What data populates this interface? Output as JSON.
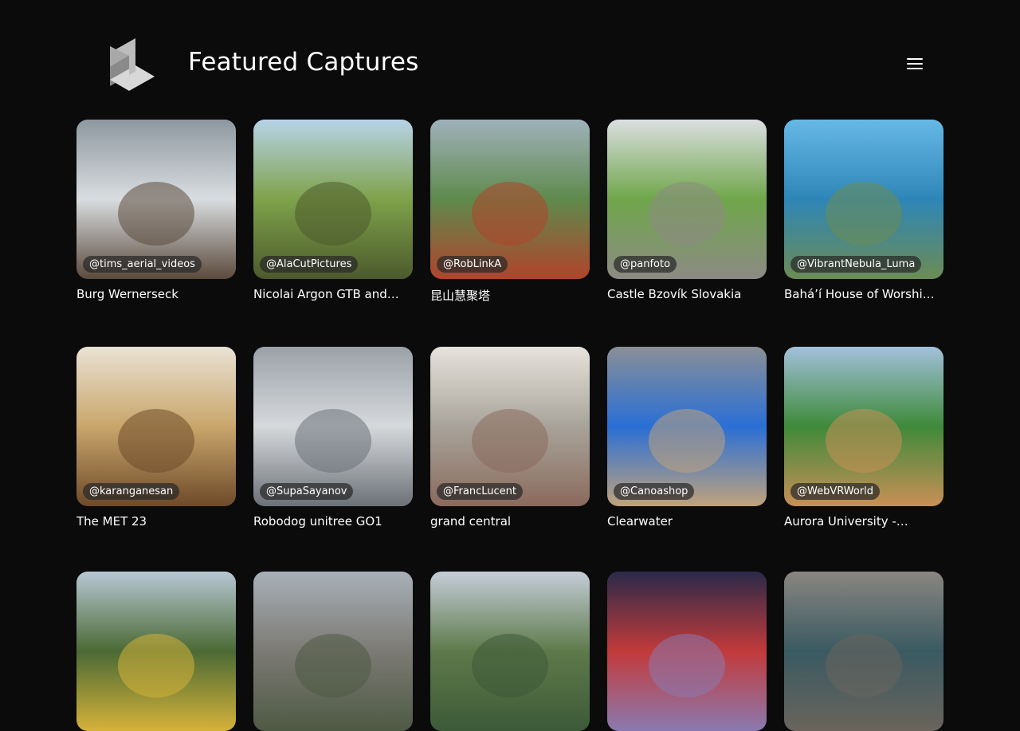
{
  "header": {
    "title": "Featured Captures",
    "logo_icon": "cube-logo-icon",
    "menu_icon": "hamburger-menu-icon"
  },
  "captures": [
    {
      "handle": "@tims_aerial_videos",
      "title": "Burg Wernerseck",
      "colors": [
        "#8e98a0",
        "#d9dde0",
        "#5b4a3c"
      ]
    },
    {
      "handle": "@AlaCutPictures",
      "title": "Nicolai Argon GTB and…",
      "colors": [
        "#b7d3e8",
        "#7ea24a",
        "#4c5a2c"
      ]
    },
    {
      "handle": "@RobLinkA",
      "title": "昆山慧聚塔",
      "colors": [
        "#9fb1bb",
        "#5f8a4c",
        "#b0442c"
      ]
    },
    {
      "handle": "@panfoto",
      "title": "Castle Bzovík Slovakia",
      "colors": [
        "#dcdfe2",
        "#6fa64a",
        "#8c8a84"
      ]
    },
    {
      "handle": "@VibrantNebula_Luma",
      "title": "Bahá’í House of Worship…",
      "colors": [
        "#66b9e6",
        "#2e86b8",
        "#6c8c54"
      ]
    },
    {
      "handle": "@karanganesan",
      "title": "The MET 23",
      "colors": [
        "#e9e2d4",
        "#c9a66b",
        "#6e4a2a"
      ]
    },
    {
      "handle": "@SupaSayanov",
      "title": "Robodog unitree GO1",
      "colors": [
        "#9aa1a8",
        "#d6d9dc",
        "#6c7178"
      ]
    },
    {
      "handle": "@FrancLucent",
      "title": "grand central",
      "colors": [
        "#e7e3dc",
        "#a8a39a",
        "#8a6a5c"
      ]
    },
    {
      "handle": "@Canoashop",
      "title": "Clearwater",
      "colors": [
        "#8a8f96",
        "#2a6fd6",
        "#c0a27c"
      ]
    },
    {
      "handle": "@WebVRWorld",
      "title": "Aurora University -…",
      "colors": [
        "#a3c1dc",
        "#3f8a3a",
        "#c98f56"
      ]
    },
    {
      "handle": "",
      "title": "",
      "colors": [
        "#b8c7d4",
        "#4a6a34",
        "#d6b23a"
      ]
    },
    {
      "handle": "",
      "title": "",
      "colors": [
        "#a8b0b8",
        "#7c7a74",
        "#4e5a44"
      ]
    },
    {
      "handle": "",
      "title": "",
      "colors": [
        "#c5cdd8",
        "#5e7a4a",
        "#3c5a38"
      ]
    },
    {
      "handle": "",
      "title": "",
      "colors": [
        "#2a2a4a",
        "#c23a3a",
        "#8a7ab0"
      ]
    },
    {
      "handle": "",
      "title": "",
      "colors": [
        "#8a8680",
        "#3a5a62",
        "#6a645c"
      ]
    }
  ]
}
